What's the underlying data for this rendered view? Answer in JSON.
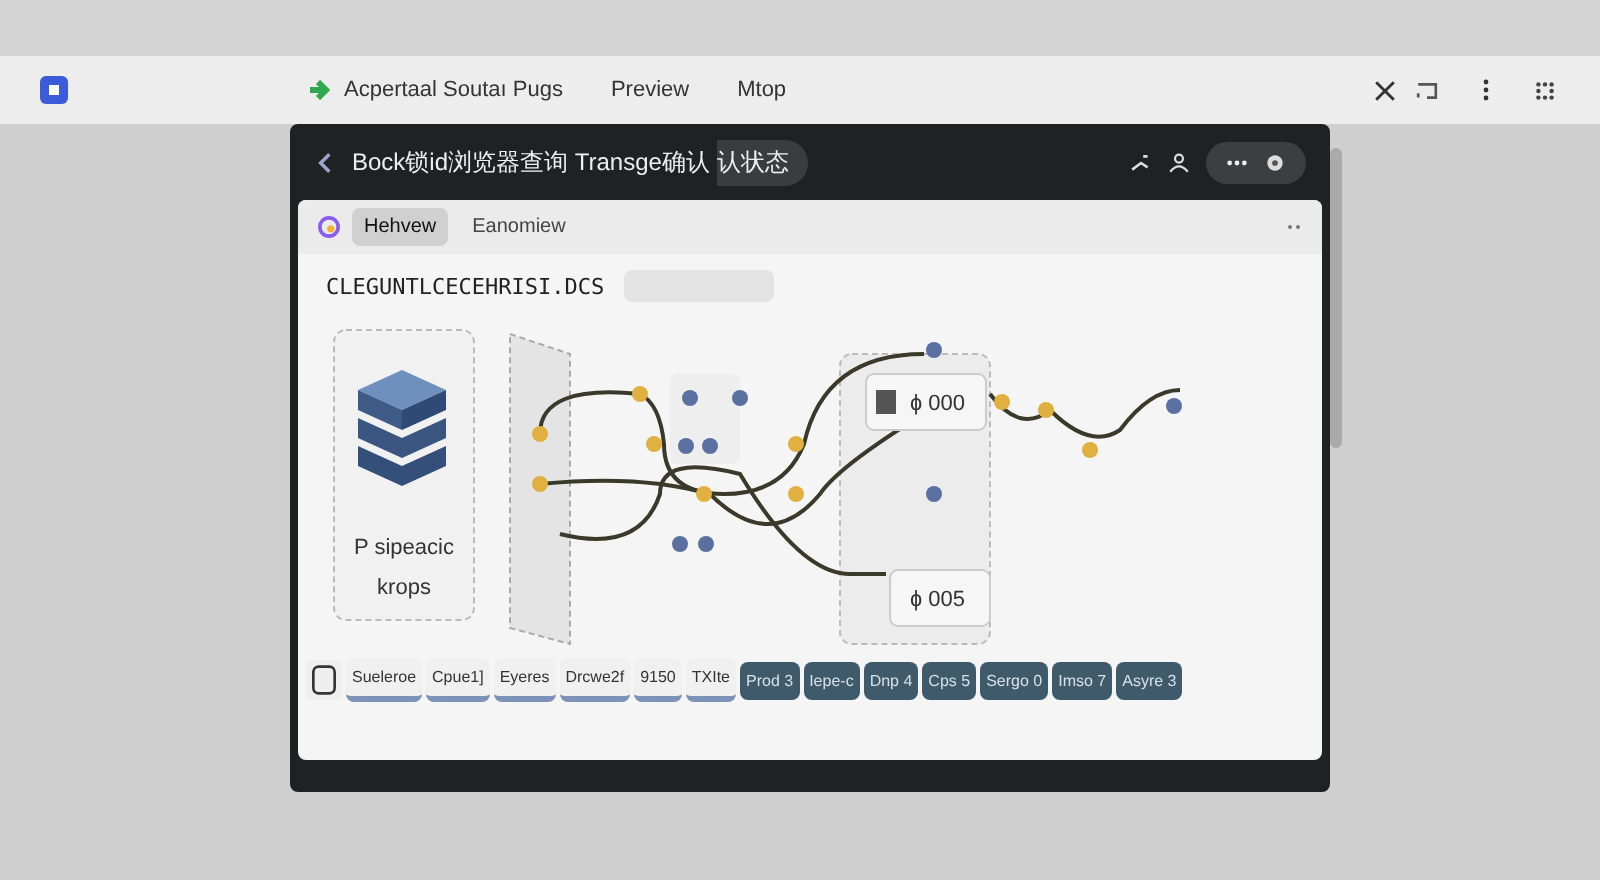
{
  "window": {
    "tabs": [
      "Acpertaal Soutaı Pugs",
      "Preview",
      "Mtop"
    ]
  },
  "panel": {
    "title": "Bock锁id浏览器查询 Transge确认 认状态",
    "doc_tabs": [
      {
        "label": "Hehvew",
        "selected": true
      },
      {
        "label": "Eanomiew",
        "selected": false
      }
    ],
    "heading": "CLEGUNTLCECEHRISI.DCS",
    "diagram": {
      "source_label": [
        "P sipeacic",
        "krops"
      ],
      "boxes": [
        "ɸ 000",
        "ɸ 005"
      ]
    },
    "bottom_tabs": [
      {
        "label": "Sueleroe",
        "kind": "light"
      },
      {
        "label": "Cpue1]",
        "kind": "light"
      },
      {
        "label": "Eyeres",
        "kind": "light"
      },
      {
        "label": "Drcwe2f",
        "kind": "light"
      },
      {
        "label": "9150",
        "kind": "light"
      },
      {
        "label": "TXIte",
        "kind": "light"
      },
      {
        "label": "Prod 3",
        "kind": "dark"
      },
      {
        "label": "Iepe-c",
        "kind": "dark"
      },
      {
        "label": "Dnp 4",
        "kind": "dark"
      },
      {
        "label": "Cps 5",
        "kind": "dark"
      },
      {
        "label": "Sergo 0",
        "kind": "dark"
      },
      {
        "label": "Imso 7",
        "kind": "dark"
      },
      {
        "label": "Asyre 3",
        "kind": "dark"
      }
    ]
  }
}
